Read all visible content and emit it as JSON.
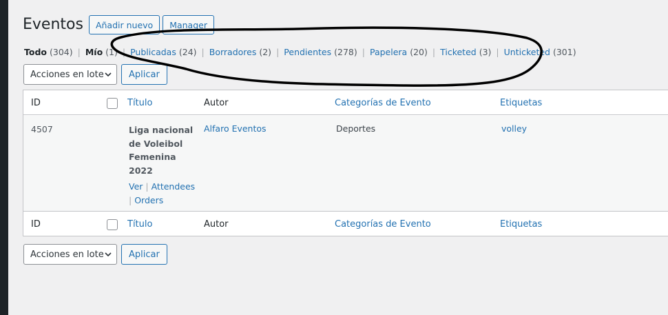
{
  "page": {
    "title": "Eventos",
    "add_new_label": "Añadir nuevo",
    "manager_label": "Manager"
  },
  "views": [
    {
      "label": "Todo",
      "count": "(304)"
    },
    {
      "label": "Mío",
      "count": "(1)"
    },
    {
      "label": "Publicadas",
      "count": "(24)"
    },
    {
      "label": "Borradores",
      "count": "(2)"
    },
    {
      "label": "Pendientes",
      "count": "(278)"
    },
    {
      "label": "Papelera",
      "count": "(20)"
    },
    {
      "label": "Ticketed",
      "count": "(3)"
    },
    {
      "label": "Unticketed",
      "count": "(301)"
    }
  ],
  "bulk": {
    "select_value": "Acciones en lote",
    "apply_label": "Aplicar"
  },
  "columns": {
    "id": "ID",
    "title": "Título",
    "author": "Autor",
    "categories": "Categorías de Evento",
    "tags": "Etiquetas"
  },
  "rows": [
    {
      "id": "4507",
      "title_lines": [
        "Liga nacional",
        "de Voleibol",
        "Femenina",
        "2022"
      ],
      "actions": {
        "view": "Ver",
        "attendees": "Attendees",
        "orders": "Orders"
      },
      "author": "Alfaro Eventos",
      "category": "Deportes",
      "tags": "volley"
    }
  ],
  "colors": {
    "accent": "#2271b1",
    "admin_bar": "#1d2327",
    "background": "#f0f0f1"
  }
}
